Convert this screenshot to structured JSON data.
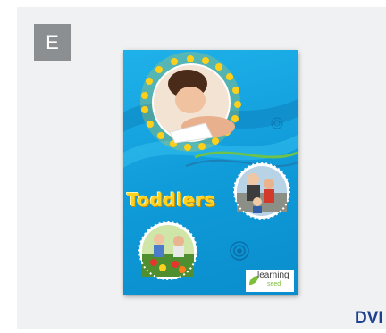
{
  "panel": {
    "badge_letter": "E",
    "format_label": "DVI"
  },
  "cover": {
    "title": "Toddlers",
    "brand_name": "learning",
    "brand_sub": "seed"
  },
  "colors": {
    "panel_bg": "#f0f1f2",
    "badge_bg": "#8c8f92",
    "cover_blue": "#1fb1ea",
    "title_yellow": "#ffd21f",
    "dvd_blue": "#1c3f8f"
  }
}
